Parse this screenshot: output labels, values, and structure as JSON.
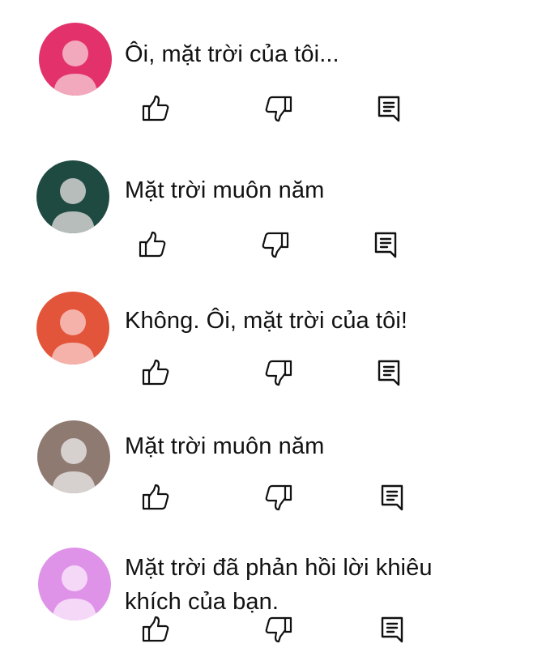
{
  "comments": [
    {
      "text": "Ôi, mặt trời của tôi...",
      "avatar_bg": "#e3326b",
      "avatar_fg": "#f2a8bd"
    },
    {
      "text": "Mặt trời muôn năm",
      "avatar_bg": "#1f4a42",
      "avatar_fg": "#b6bdbb"
    },
    {
      "text": "Không. Ôi, mặt trời của tôi!",
      "avatar_bg": "#e2553a",
      "avatar_fg": "#f5b2aa"
    },
    {
      "text": "Mặt trời muôn năm",
      "avatar_bg": "#8f7a72",
      "avatar_fg": "#d6d0ce"
    },
    {
      "text": "Mặt trời đã phản hồi lời khiêu\nkhích của bạn.",
      "avatar_bg": "#df93e8",
      "avatar_fg": "#f5d8f8"
    }
  ],
  "icons": {
    "like": "thumbs-up-icon",
    "dislike": "thumbs-down-icon",
    "reply": "reply-comment-icon"
  }
}
